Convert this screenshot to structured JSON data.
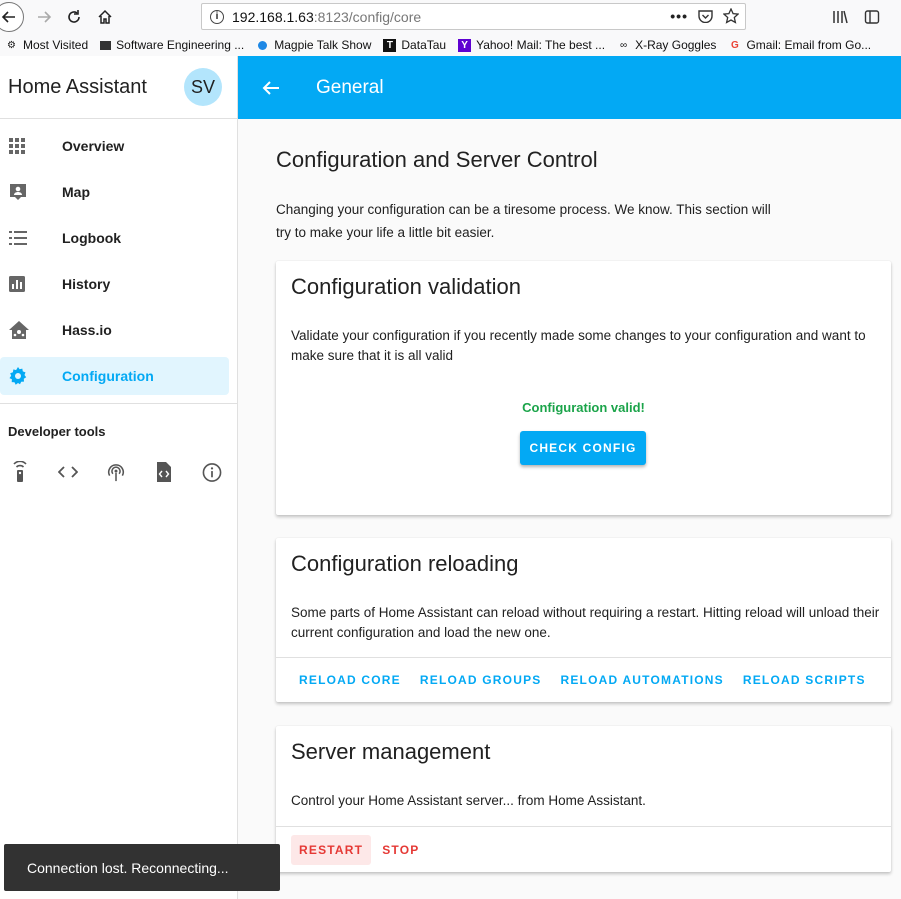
{
  "browser": {
    "url_host": "192.168.1.63",
    "url_path": ":8123/config/core",
    "bookmarks": [
      {
        "label": "Most Visited",
        "icon": "gear-icon"
      },
      {
        "label": "Software Engineering ...",
        "icon": "page-icon"
      },
      {
        "label": "Magpie Talk Show",
        "icon": "dot-icon"
      },
      {
        "label": "DataTau",
        "icon": "t-icon"
      },
      {
        "label": "Yahoo! Mail: The best ...",
        "icon": "y-icon"
      },
      {
        "label": "X-Ray Goggles",
        "icon": "goggles-icon"
      },
      {
        "label": "Gmail: Email from Go...",
        "icon": "g-icon"
      }
    ]
  },
  "sidebar": {
    "title": "Home Assistant",
    "avatar": "SV",
    "items": [
      {
        "label": "Overview",
        "icon": "grid-icon"
      },
      {
        "label": "Map",
        "icon": "map-icon"
      },
      {
        "label": "Logbook",
        "icon": "logbook-icon"
      },
      {
        "label": "History",
        "icon": "history-icon"
      },
      {
        "label": "Hass.io",
        "icon": "hassio-icon"
      },
      {
        "label": "Configuration",
        "icon": "gear-icon"
      }
    ],
    "dev_title": "Developer tools"
  },
  "topbar": {
    "title": "General"
  },
  "main": {
    "heading": "Configuration and Server Control",
    "intro": "Changing your configuration can be a tiresome process. We know. This section will try to make your life a little bit easier.",
    "validation": {
      "title": "Configuration validation",
      "text": "Validate your configuration if you recently made some changes to your configuration and want to make sure that it is all valid",
      "status": "Configuration valid!",
      "button": "CHECK CONFIG"
    },
    "reloading": {
      "title": "Configuration reloading",
      "text": "Some parts of Home Assistant can reload without requiring a restart. Hitting reload will unload their current configuration and load the new one.",
      "buttons": [
        "RELOAD CORE",
        "RELOAD GROUPS",
        "RELOAD AUTOMATIONS",
        "RELOAD SCRIPTS"
      ]
    },
    "server": {
      "title": "Server management",
      "text": "Control your Home Assistant server... from Home Assistant.",
      "restart": "RESTART",
      "stop": "STOP"
    }
  },
  "toast": "Connection lost. Reconnecting..."
}
